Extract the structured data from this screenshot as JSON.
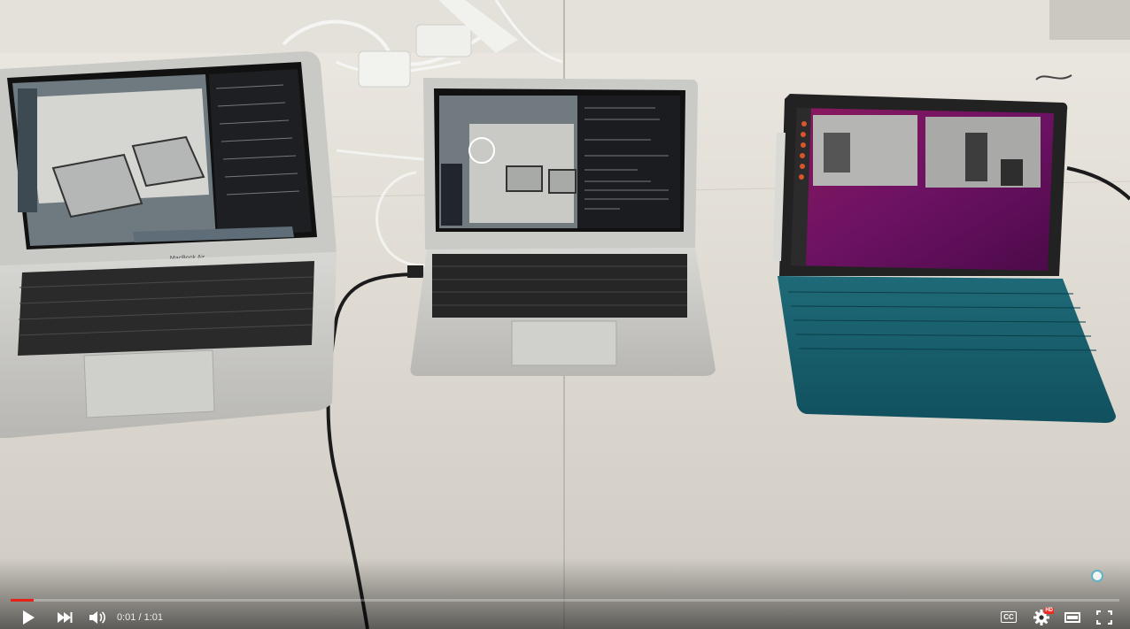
{
  "player": {
    "progress_fraction": 0.0208,
    "loaded_fraction": 0.0208,
    "time": {
      "current": "0:01",
      "separator": " / ",
      "duration": "1:01"
    },
    "controls": {
      "play_icon": "play-icon",
      "next_icon": "next-icon",
      "volume_icon": "volume-icon",
      "captions_label": "CC",
      "settings_icon": "gear-icon",
      "hd_badge": "HD",
      "theater_icon": "theater-mode-icon",
      "fullscreen_icon": "fullscreen-icon"
    },
    "colors": {
      "progress": "#e62117",
      "hd_badge": "#f12b24"
    }
  },
  "scene": {
    "left_laptop_brand": "MacBook Air"
  }
}
